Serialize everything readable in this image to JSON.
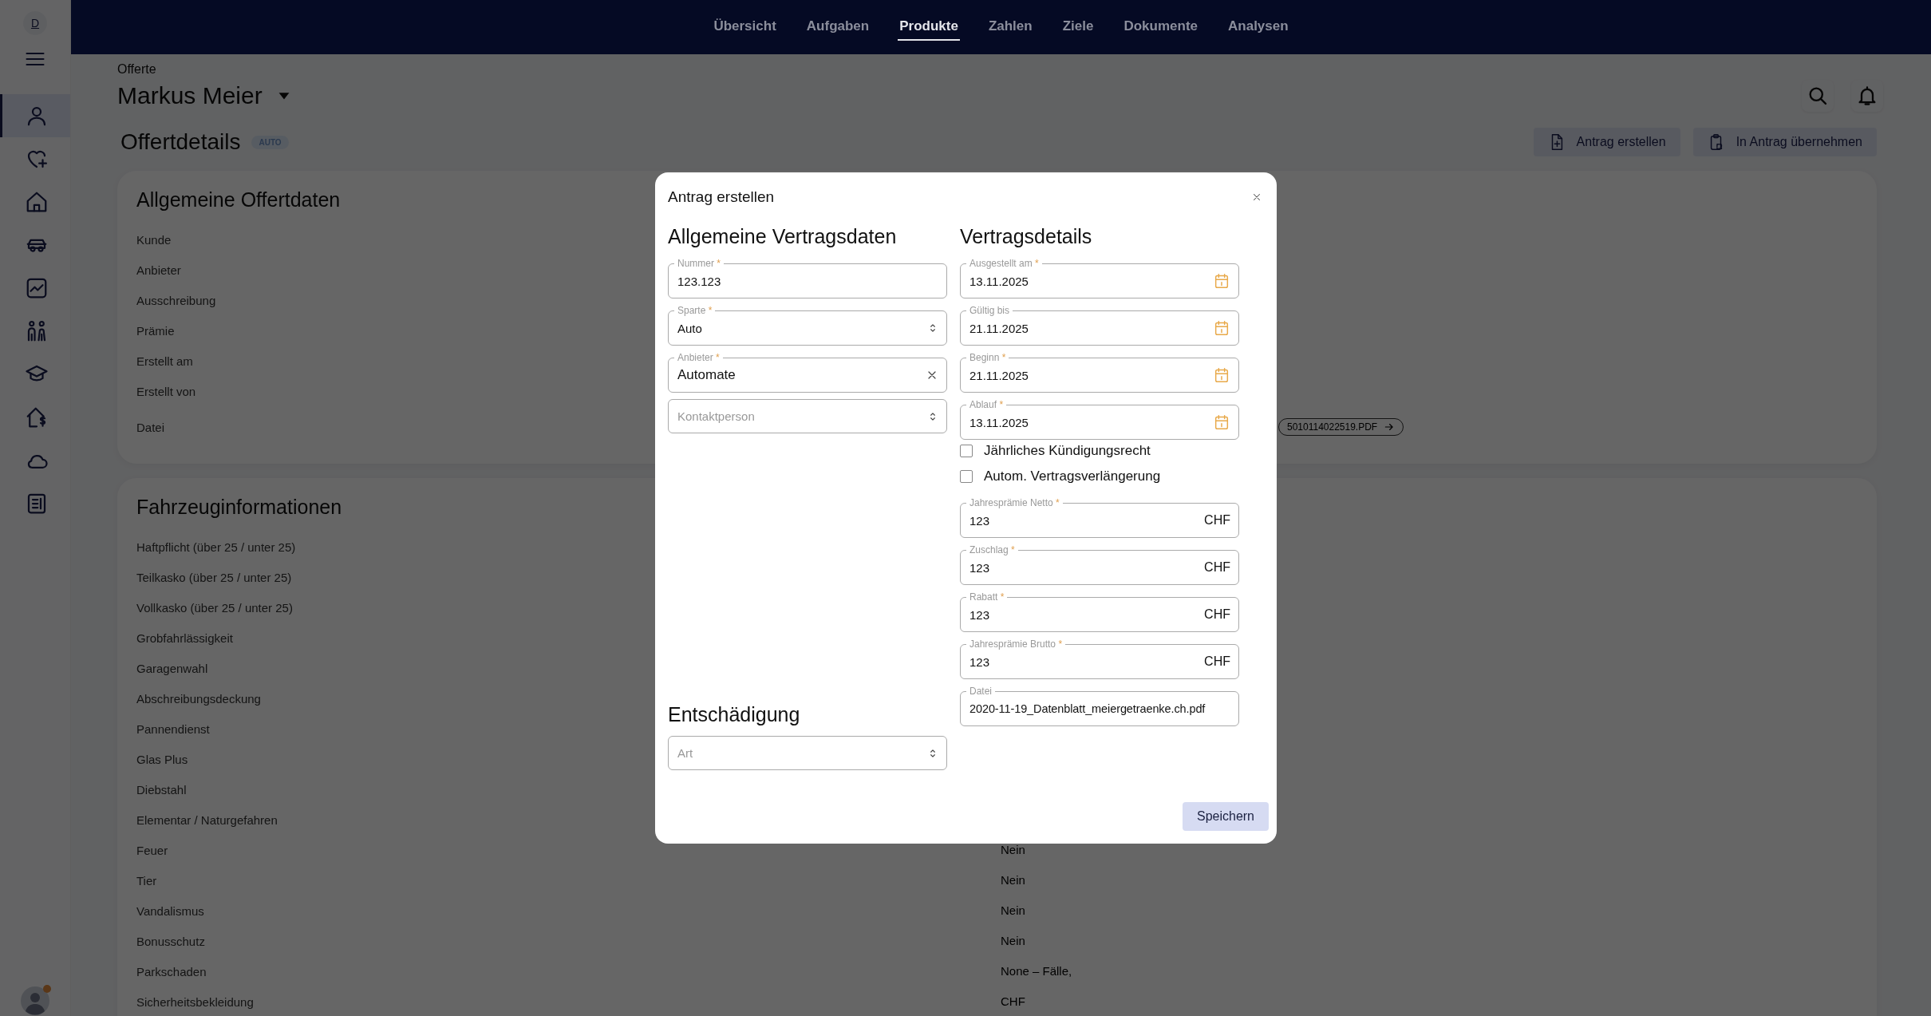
{
  "sidebar": {
    "account_letter": "D",
    "items": [
      {
        "kind": "person",
        "selected": true
      },
      {
        "kind": "heart",
        "selected": false
      },
      {
        "kind": "home",
        "selected": false
      },
      {
        "kind": "car",
        "selected": false
      },
      {
        "kind": "chart",
        "selected": false
      },
      {
        "kind": "family",
        "selected": false
      },
      {
        "kind": "graduation",
        "selected": false
      },
      {
        "kind": "house-price",
        "selected": false
      },
      {
        "kind": "cloud",
        "selected": false
      },
      {
        "kind": "document",
        "selected": false
      }
    ]
  },
  "top_nav": [
    {
      "label": "Übersicht",
      "selected": false
    },
    {
      "label": "Aufgaben",
      "selected": false
    },
    {
      "label": "Produkte",
      "selected": true
    },
    {
      "label": "Zahlen",
      "selected": false
    },
    {
      "label": "Ziele",
      "selected": false
    },
    {
      "label": "Dokumente",
      "selected": false
    },
    {
      "label": "Analysen",
      "selected": false
    }
  ],
  "breadcrumb": "Offerte",
  "customer": "Markus Meier",
  "section_title": "Offertdetails",
  "badge": "AUTO",
  "actions": [
    {
      "kind": "file-plus",
      "label": "Antrag erstellen"
    },
    {
      "kind": "clipboard",
      "label": "In Antrag übernehmen"
    }
  ],
  "cards": [
    {
      "title": "Allgemeine Offertdaten",
      "rows": [
        {
          "label": "Kunde"
        },
        {
          "label": "Anbieter"
        },
        {
          "label": "Ausschreibung"
        },
        {
          "label": "Prämie"
        },
        {
          "label": "Erstellt am"
        },
        {
          "label": "Erstellt von"
        },
        {
          "label": "Datei",
          "kind": "file",
          "value": "5010114022519.PDF"
        }
      ]
    },
    {
      "title": "Fahrzeuginformationen",
      "rows": [
        {
          "label": "Haftpflicht (über 25 / unter 25)"
        },
        {
          "label": "Teilkasko (über 25 / unter 25)"
        },
        {
          "label": "Vollkasko (über 25 / unter 25)"
        },
        {
          "label": "Grobfahrlässigkeit"
        },
        {
          "label": "Garagenwahl"
        },
        {
          "label": "Abschreibungsdeckung"
        },
        {
          "label": "Pannendienst"
        },
        {
          "label": "Glas Plus"
        },
        {
          "label": "Diebstahl"
        },
        {
          "label": "Elementar / Naturgefahren"
        },
        {
          "label": "Feuer",
          "value": "Nein"
        },
        {
          "label": "Tier",
          "value": "Nein"
        },
        {
          "label": "Vandalismus",
          "value": "Nein"
        },
        {
          "label": "Bonusschutz",
          "value": "Nein"
        },
        {
          "label": "Parkschaden",
          "value": "None – Fälle,"
        },
        {
          "label": "Sicherheitsbekleidung",
          "value": "CHF"
        }
      ]
    }
  ],
  "modal": {
    "title": "Antrag erstellen",
    "columns": [
      {
        "sections": [
          {
            "heading": "Allgemeine Vertragsdaten",
            "fields": [
              {
                "kind": "text",
                "label": "Nummer",
                "required_mark": "*",
                "value": "123.123"
              },
              {
                "kind": "select",
                "label": "Sparte",
                "required_mark": "*",
                "value": "Auto"
              },
              {
                "kind": "clearable",
                "label": "Anbieter",
                "required_mark": "*",
                "value": "Automate"
              },
              {
                "kind": "select",
                "placeholder": "Kontaktperson"
              }
            ]
          },
          {
            "heading": "Entschädigung",
            "fields": [
              {
                "kind": "select",
                "placeholder": "Art"
              }
            ]
          }
        ]
      },
      {
        "sections": [
          {
            "heading": "Vertragsdetails",
            "fields": [
              {
                "kind": "date",
                "label": "Ausgestellt am",
                "required_mark": "*",
                "value": "13.11.2025"
              },
              {
                "kind": "date",
                "label": "Gültig bis",
                "value": "21.11.2025"
              },
              {
                "kind": "date",
                "label": "Beginn",
                "required_mark": "*",
                "value": "21.11.2025"
              },
              {
                "kind": "date",
                "label": "Ablauf",
                "required_mark": "*",
                "value": "13.11.2025"
              },
              {
                "kind": "checkbox",
                "label": "Jährliches Kündigungsrecht",
                "checked": false
              },
              {
                "kind": "checkbox",
                "label": "Autom. Vertragsverlängerung",
                "checked": false
              },
              {
                "kind": "currency",
                "label": "Jahresprämie Netto",
                "required_mark": "*",
                "value": "123",
                "suffix": "CHF"
              },
              {
                "kind": "currency",
                "label": "Zuschlag",
                "required_mark": "*",
                "value": "123",
                "suffix": "CHF"
              },
              {
                "kind": "currency",
                "label": "Rabatt",
                "required_mark": "*",
                "value": "123",
                "suffix": "CHF"
              },
              {
                "kind": "currency",
                "label": "Jahresprämie Brutto",
                "required_mark": "*",
                "value": "123",
                "suffix": "CHF"
              },
              {
                "kind": "text",
                "label": "Datei",
                "value": "2020-11-19_Datenblatt_meiergetraenke.ch.pdf"
              }
            ]
          }
        ]
      }
    ],
    "submit": "Speichern"
  }
}
